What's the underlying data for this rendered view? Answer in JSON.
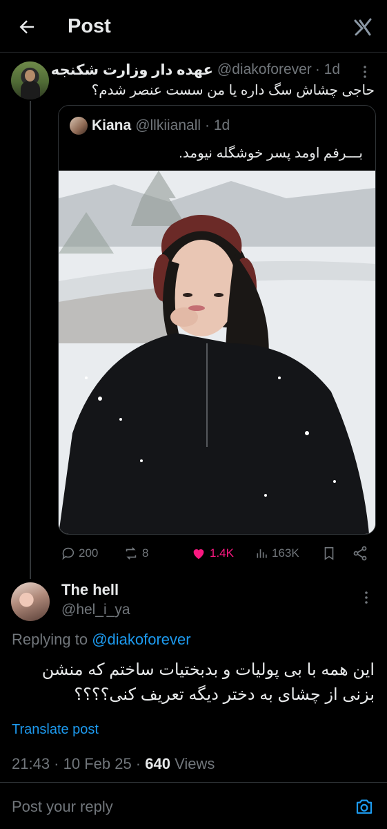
{
  "header": {
    "title": "Post"
  },
  "post": {
    "display_name": "عهده دار وزارت شکنجه",
    "handle": "@diakoforever",
    "time": "· 1d",
    "text": "حاجی چشاش سگ داره یا من سست عنصر شدم؟"
  },
  "quote": {
    "display_name": "Kiana",
    "handle": "@llkiianall",
    "time": "· 1d",
    "text": "بـــرفم اومد پسر خوشگله نیومد."
  },
  "actions": {
    "replies": "200",
    "reposts": "8",
    "likes": "1.4K",
    "views": "163K"
  },
  "reply": {
    "display_name": "The hell",
    "handle": "@hel_i_ya",
    "replying_to_prefix": "Replying to",
    "replying_to_handle": "@diakoforever",
    "text": "این همه با بی پولیات و بدبختیات ساختم که منشن بزنی از چشای به دختر دیگه تعریف کنی؟؟؟؟",
    "translate_label": "Translate post",
    "timestamp": "21:43 · 10 Feb 25 · ",
    "views_count": "640",
    "views_label": "Views"
  },
  "composer": {
    "placeholder": "Post your reply"
  },
  "colors": {
    "accent": "#1d9bf0",
    "like": "#f91880",
    "muted": "#71767b",
    "background": "#000000"
  }
}
